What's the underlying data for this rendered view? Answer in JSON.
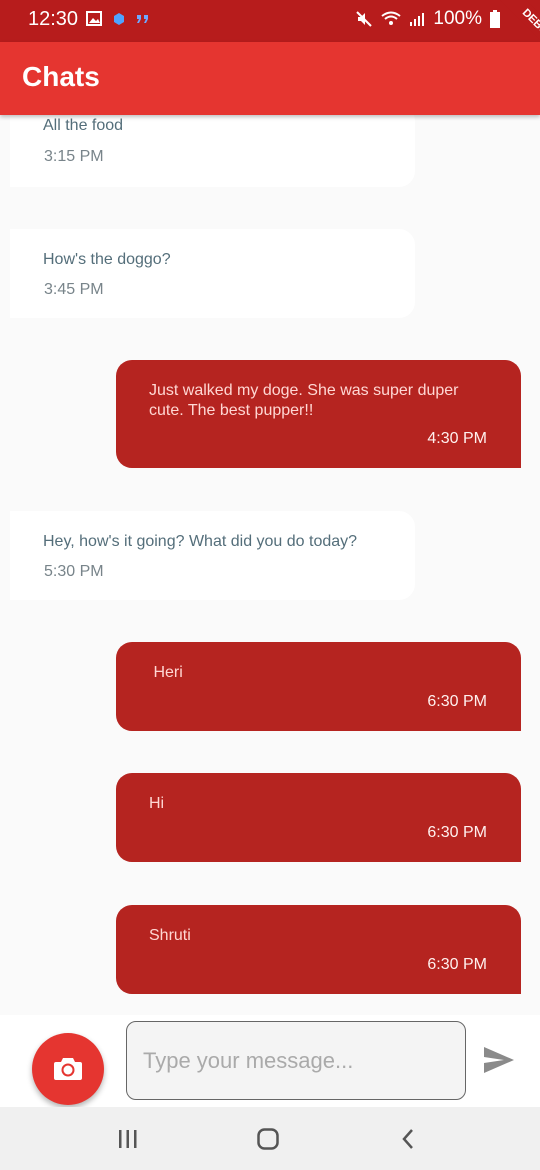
{
  "status_bar": {
    "time": "12:30",
    "battery": "100%"
  },
  "app_bar": {
    "title": "Chats",
    "debug_banner": "DEBUG"
  },
  "messages": [
    {
      "direction": "incoming",
      "text": "All the food",
      "time": "3:15 PM"
    },
    {
      "direction": "incoming",
      "text": "How's the doggo?",
      "time": "3:45 PM"
    },
    {
      "direction": "outgoing",
      "text": "Just walked my doge. She was super duper cute. The best pupper!!",
      "time": "4:30 PM"
    },
    {
      "direction": "incoming",
      "text": "Hey, how's it going? What did you do today?",
      "time": "5:30 PM"
    },
    {
      "direction": "outgoing",
      "text": " Heri",
      "time": "6:30 PM"
    },
    {
      "direction": "outgoing",
      "text": "Hi",
      "time": "6:30 PM"
    },
    {
      "direction": "outgoing",
      "text": "Shruti",
      "time": "6:30 PM"
    }
  ],
  "composer": {
    "placeholder": "Type your message...",
    "value": "",
    "camera_icon": "camera-icon",
    "send_icon": "send-icon"
  },
  "nav_bar": {
    "icons": [
      "recent-apps-icon",
      "home-icon",
      "back-icon"
    ]
  },
  "colors": {
    "primary": "#e53530",
    "primary_dark": "#b71c1c",
    "outgoing_bubble": "#b52420",
    "incoming_text": "#546e7a"
  }
}
